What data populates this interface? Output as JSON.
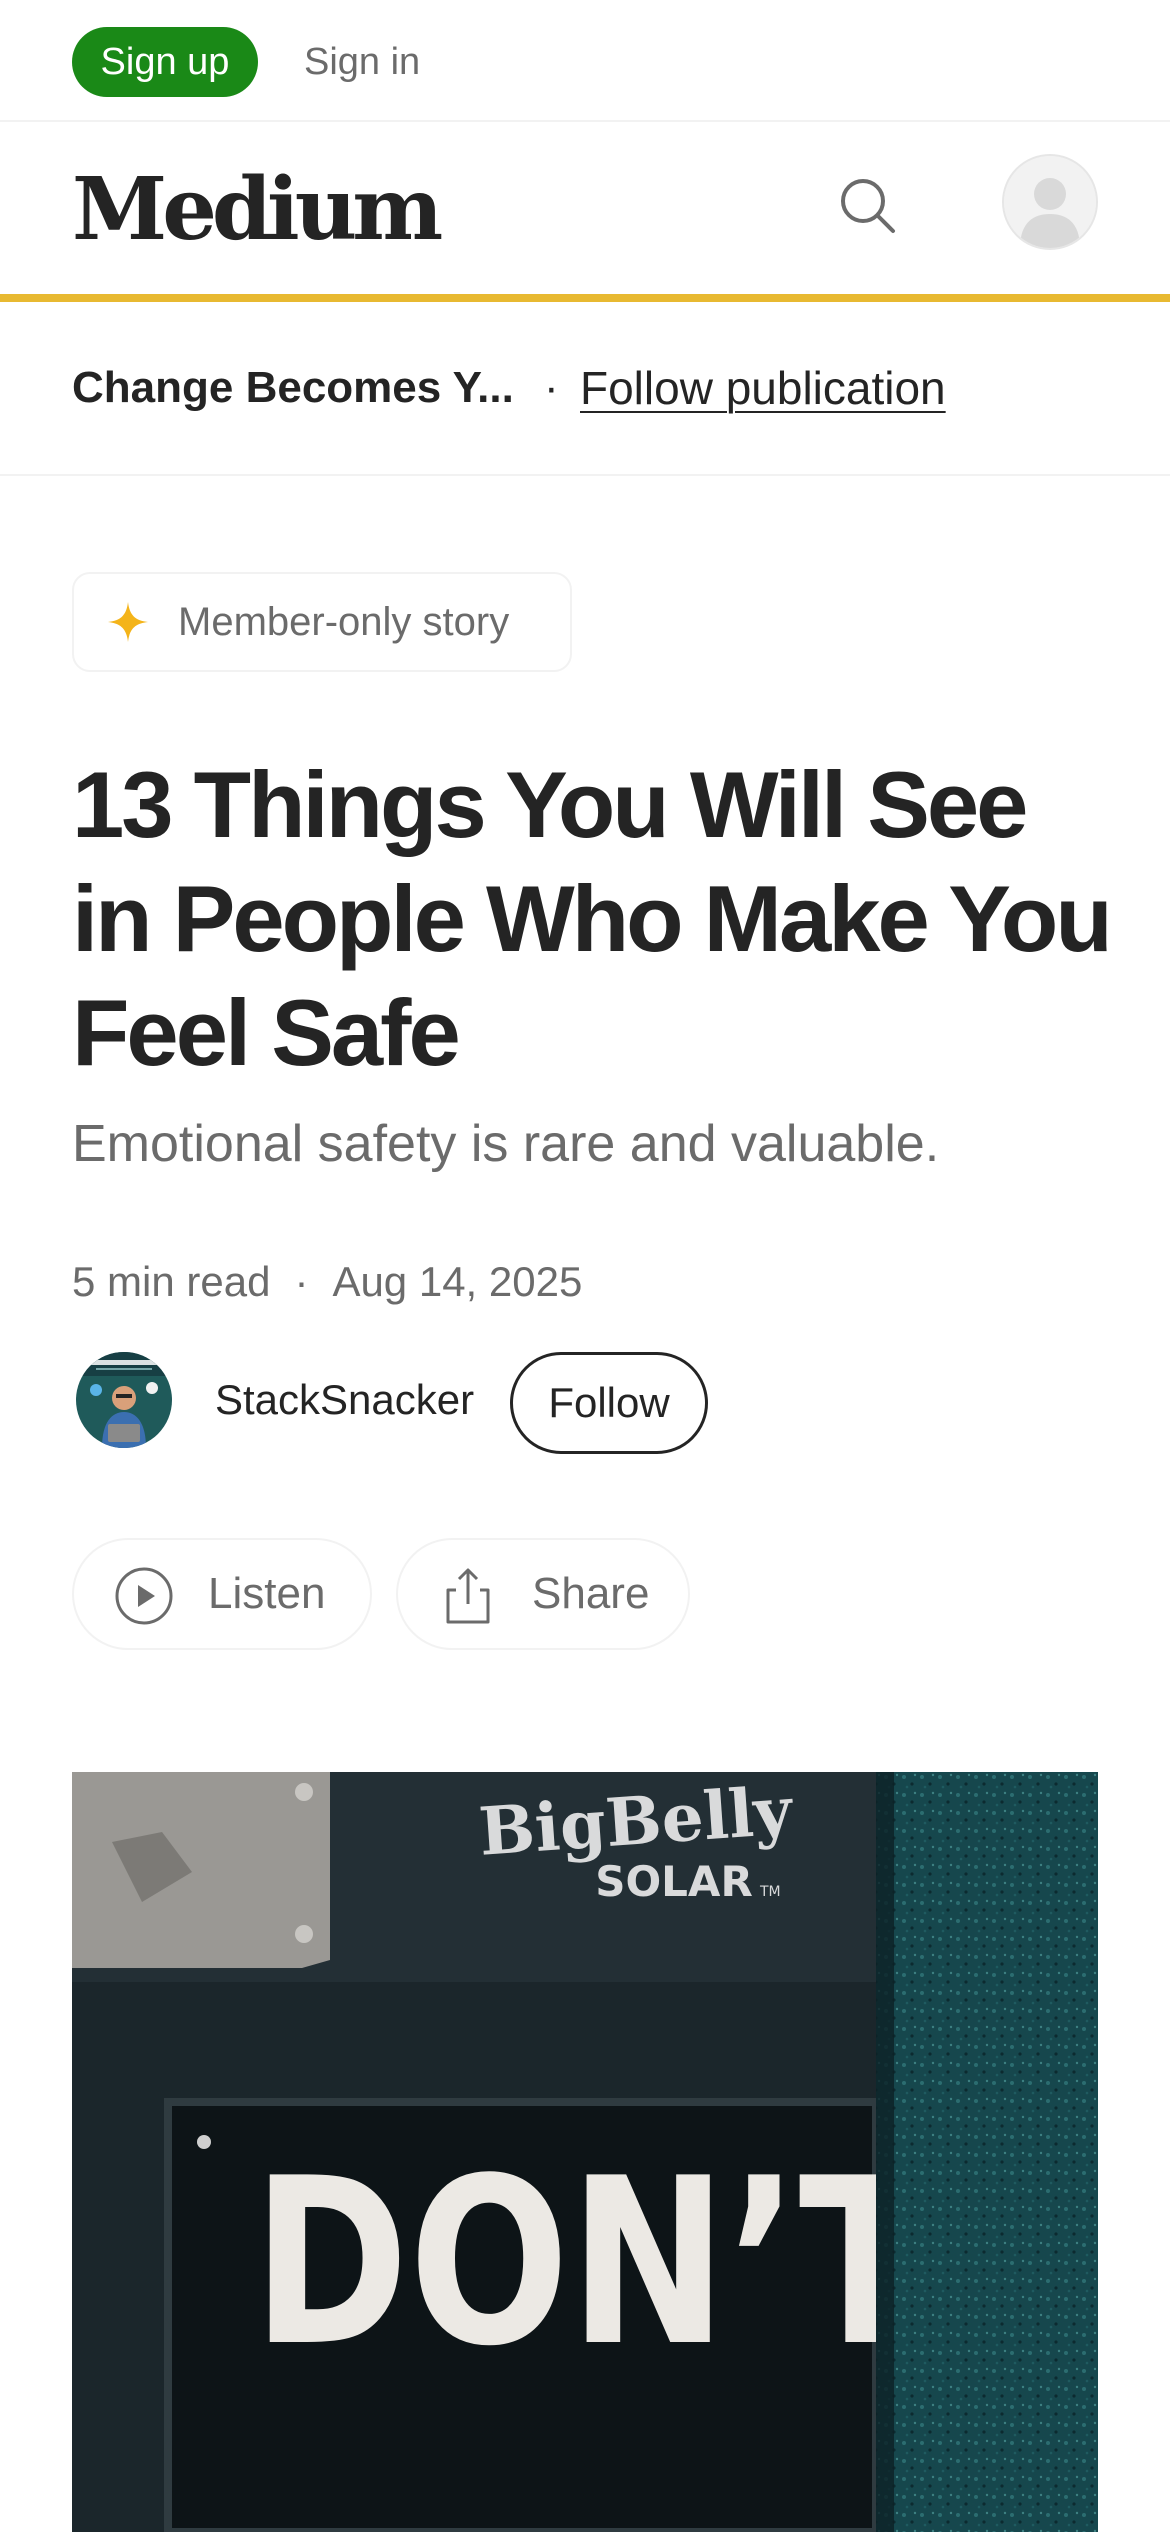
{
  "topbar": {
    "signup_label": "Sign up",
    "signin_label": "Sign in"
  },
  "header": {
    "logo_text": "Medium",
    "search_icon": "search-icon",
    "avatar_icon": "user-avatar-placeholder"
  },
  "publication": {
    "name": "Change Becomes Y...",
    "separator": "·",
    "follow_label": "Follow publication"
  },
  "story": {
    "badge_label": "Member-only story",
    "badge_icon": "sparkle-star-icon",
    "title": "13 Things You Will See in People Who Make You Feel Safe",
    "subtitle": "Emotional safety is rare and valuable.",
    "read_time": "5 min read",
    "meta_separator": "·",
    "date": "Aug 14, 2025",
    "author_name": "StackSnacker",
    "follow_label": "Follow"
  },
  "actions": {
    "listen_label": "Listen",
    "share_label": "Share"
  },
  "hero_image": {
    "brand_text_top": "BigBelly",
    "brand_text_bottom": "SOLAR",
    "trademark": "TM",
    "sign_text": "DON’T"
  },
  "colors": {
    "signup_green": "#1a8917",
    "accent_yellow": "#e8b931",
    "star_yellow": "#f4b41a",
    "text_primary": "#242424",
    "text_secondary": "#6b6b6b"
  }
}
